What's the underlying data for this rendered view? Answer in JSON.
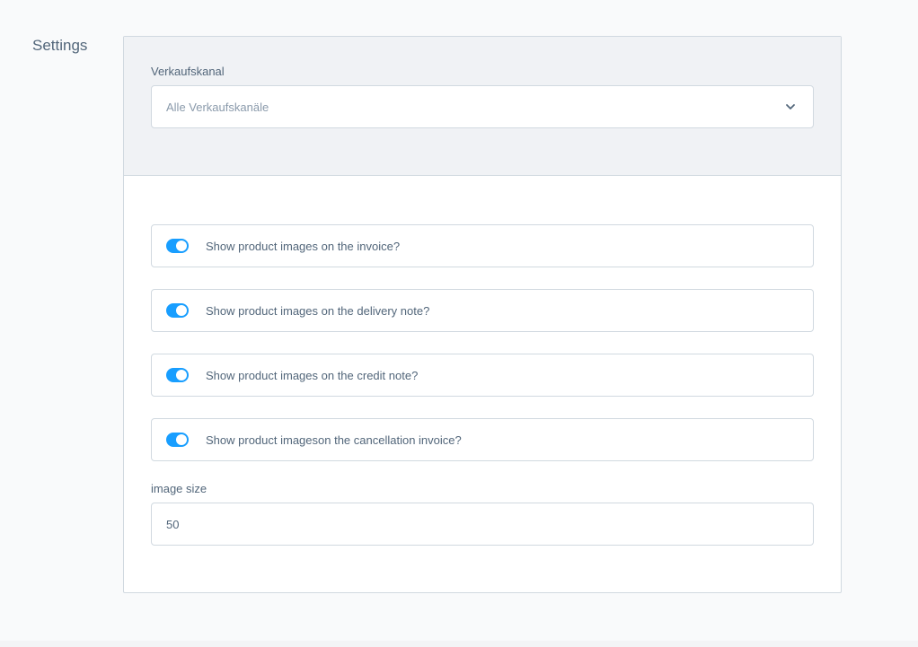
{
  "section": {
    "title": "Settings"
  },
  "sales_channel": {
    "label": "Verkaufskanal",
    "selected": "Alle Verkaufskanäle",
    "icon": "chevron-down-icon"
  },
  "toggles": [
    {
      "label": "Show product images on the invoice?",
      "enabled": true
    },
    {
      "label": "Show product images on the delivery note?",
      "enabled": true
    },
    {
      "label": "Show product images on the credit note?",
      "enabled": true
    },
    {
      "label": "Show product imageson the cancellation invoice?",
      "enabled": true
    }
  ],
  "image_size": {
    "label": "image size",
    "value": "50"
  },
  "colors": {
    "accent": "#189eff",
    "border": "#d1d9e0",
    "text": "#52667a",
    "muted": "#8a9aab",
    "header_bg": "#f0f2f5",
    "page_bg": "#f9fafb"
  }
}
